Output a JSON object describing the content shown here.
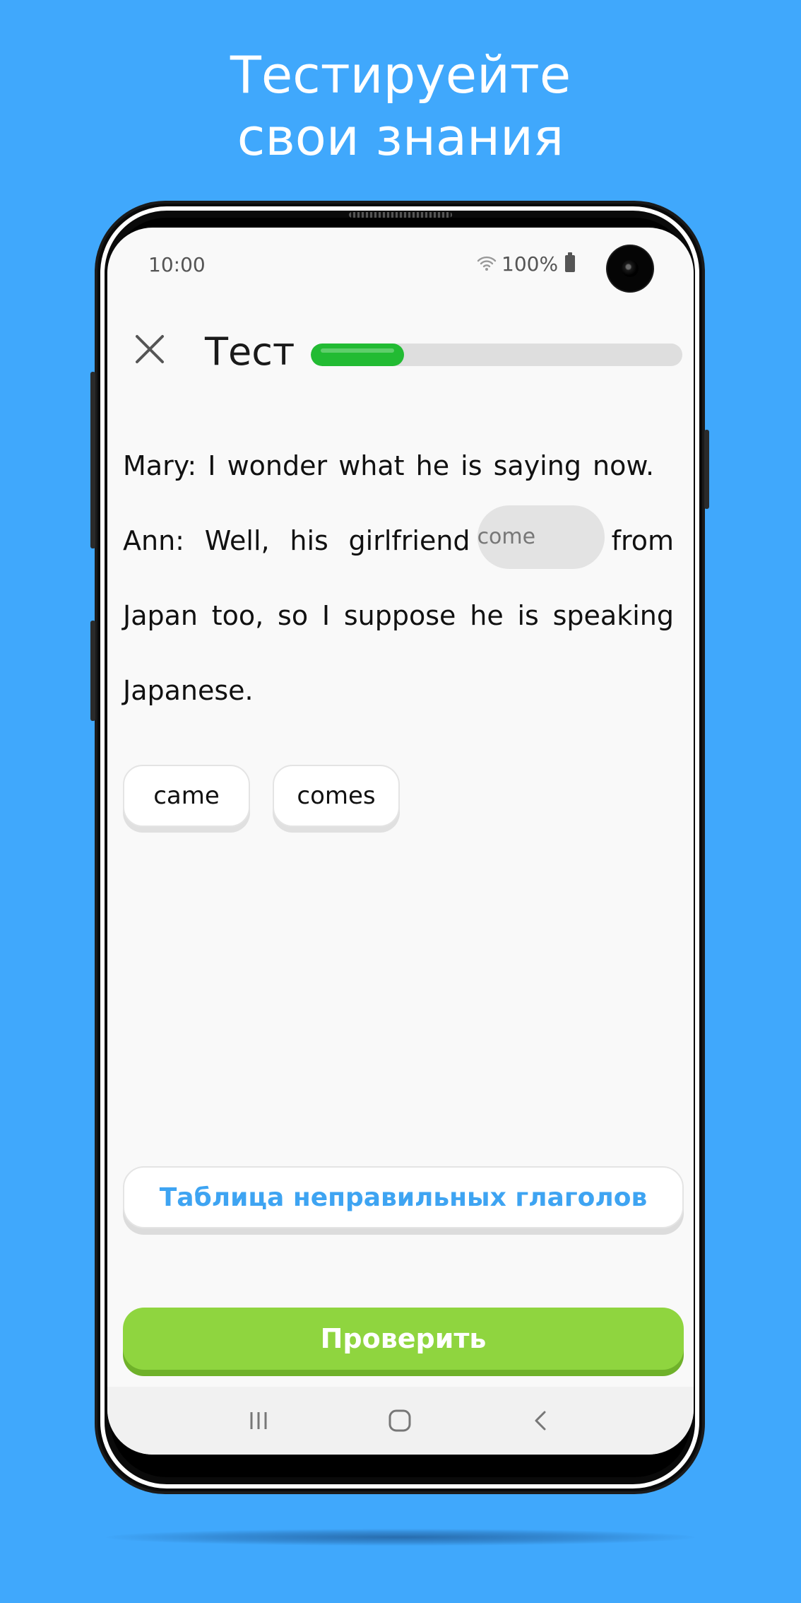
{
  "promo": {
    "line1": "Тестируейте",
    "line2": "свои знания",
    "background_color": "#40a8fc"
  },
  "status_bar": {
    "time": "10:00",
    "battery": "100%",
    "icons": [
      "wifi-icon",
      "battery-icon",
      "front-camera"
    ]
  },
  "header": {
    "close_icon": "close-icon",
    "title": "Тест",
    "progress": 0.25,
    "progress_color": "#22bb33"
  },
  "question": {
    "line1": "Mary: I wonder what he is saying now.",
    "before_blank": "Ann: Well, his girlfriend",
    "blank_value": "come",
    "after_blank": "from Japan too, so I suppose he is speaking Japanese."
  },
  "options": [
    {
      "label": "came"
    },
    {
      "label": "comes"
    }
  ],
  "buttons": {
    "verbs_table": "Таблица неправильных глаголов",
    "check": "Проверить",
    "verbs_table_color": "#3ea4f2",
    "check_color": "#8fd53f"
  },
  "nav_bar": {
    "icons": [
      "recent-apps-icon",
      "home-icon",
      "back-icon"
    ]
  }
}
